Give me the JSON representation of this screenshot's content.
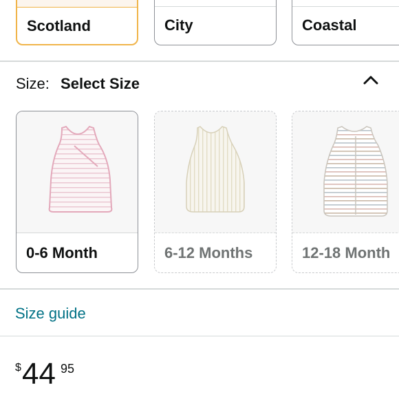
{
  "style_options": [
    {
      "label": "Scotland",
      "selected": true
    },
    {
      "label": "City",
      "selected": false
    },
    {
      "label": "Coastal",
      "selected": false
    }
  ],
  "size_selector": {
    "key_label": "Size:",
    "value_label": "Select Size",
    "toggle_icon": "chevron-up-icon"
  },
  "size_options": [
    {
      "label": "0-6 Month",
      "available": true,
      "image": "pink-striped-sleep-sack"
    },
    {
      "label": "6-12 Months",
      "available": false,
      "image": "beige-striped-sleep-sack"
    },
    {
      "label": "12-18 Month",
      "available": false,
      "image": "multicolor-striped-sleep-sack"
    }
  ],
  "size_guide_label": "Size guide",
  "price": {
    "symbol": "$",
    "whole": "44",
    "fraction": "95"
  },
  "colors": {
    "selected_border": "#f0b449",
    "link": "#007185",
    "text": "#0f1111",
    "unavailable_text": "#6f7373"
  }
}
